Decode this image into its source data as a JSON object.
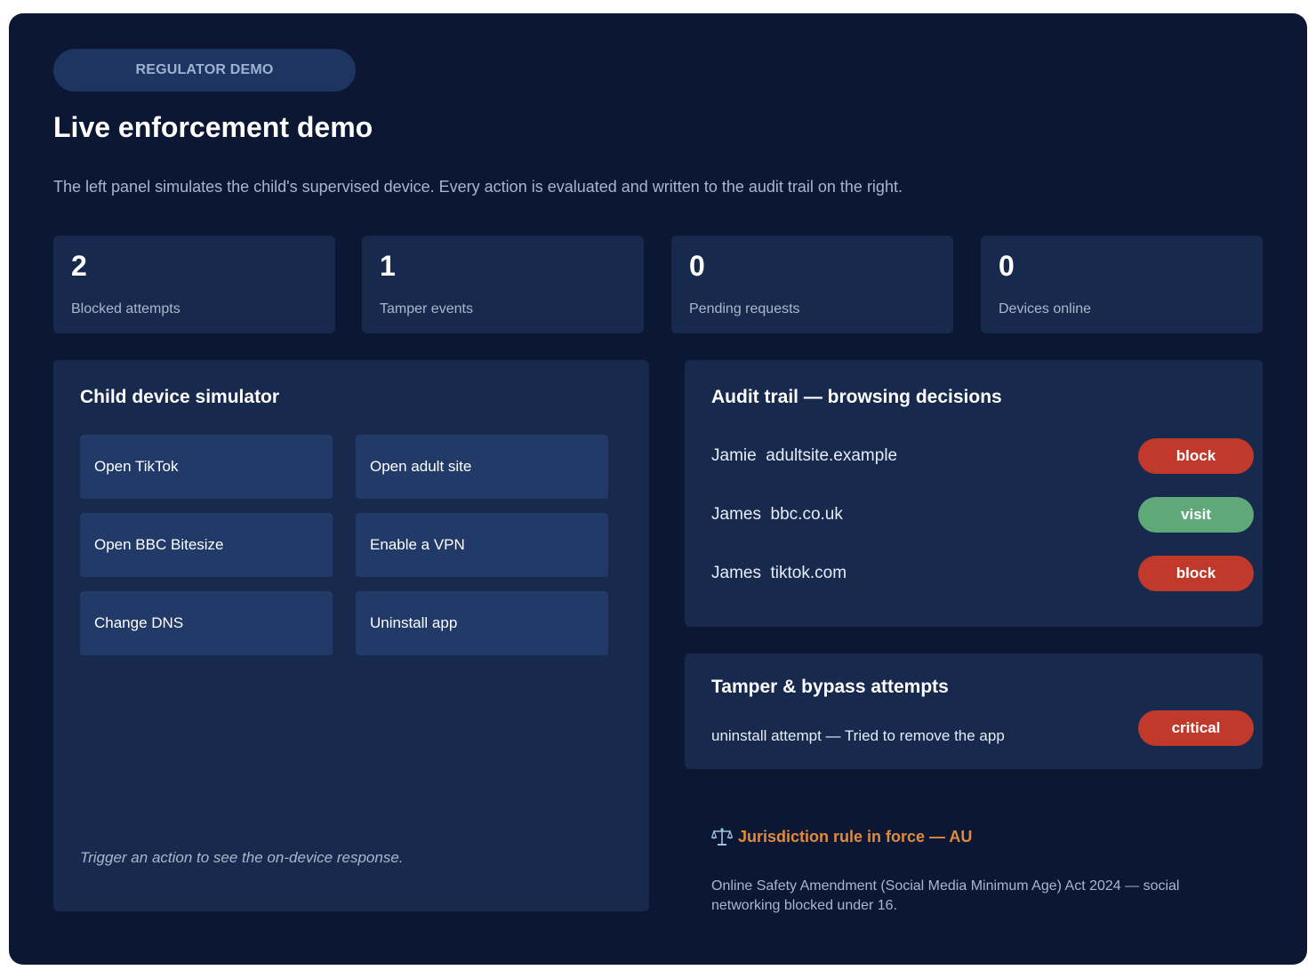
{
  "header": {
    "badge": "REGULATOR DEMO",
    "title": "Live enforcement demo",
    "subtitle": "The left panel simulates the child's supervised device. Every action is evaluated and written to the audit trail on the right."
  },
  "stats": [
    {
      "value": "2",
      "label": "Blocked attempts"
    },
    {
      "value": "1",
      "label": "Tamper events"
    },
    {
      "value": "0",
      "label": "Pending requests"
    },
    {
      "value": "0",
      "label": "Devices online"
    }
  ],
  "simulator": {
    "title": "Child device simulator",
    "actions": [
      "Open TikTok",
      "Open adult site",
      "Open BBC Bitesize",
      "Enable a VPN",
      "Change DNS",
      "Uninstall app"
    ],
    "hint": "Trigger an action to see the on-device response."
  },
  "audit": {
    "title": "Audit trail — browsing decisions",
    "rows": [
      {
        "user": "Jamie",
        "domain": "adultsite.example",
        "decision": "block"
      },
      {
        "user": "James",
        "domain": "bbc.co.uk",
        "decision": "visit"
      },
      {
        "user": "James",
        "domain": "tiktok.com",
        "decision": "block"
      }
    ]
  },
  "tamper": {
    "title": "Tamper & bypass attempts",
    "rows": [
      {
        "text": "uninstall attempt — Tried to remove the app",
        "severity": "critical"
      }
    ]
  },
  "jurisdiction": {
    "icon": "balance-scale-icon",
    "title": "Jurisdiction rule in force — AU",
    "text": "Online Safety Amendment (Social Media Minimum Age) Act 2024 — social networking blocked under 16."
  },
  "colors": {
    "background": "#0b1733",
    "panel": "#172a4d",
    "button": "#213a67",
    "block": "#c0392b",
    "visit": "#5fa878",
    "accent": "#e08b3c"
  }
}
